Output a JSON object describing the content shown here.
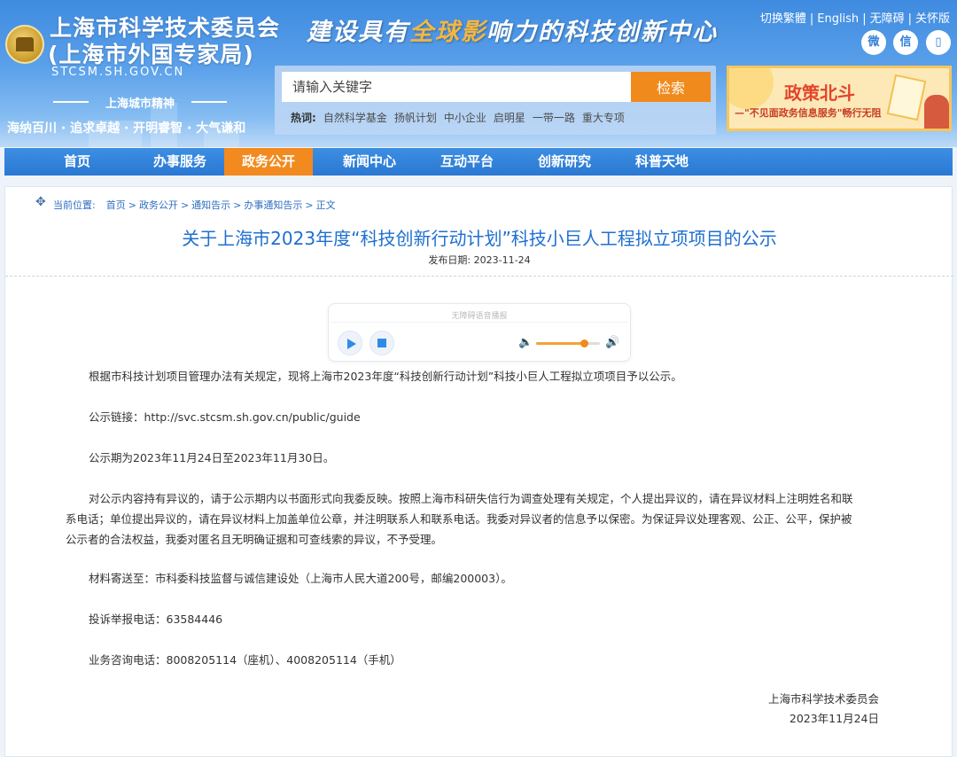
{
  "header": {
    "org_name": "上海市科学技术委员会",
    "org_name_alt": "(上海市外国专家局)",
    "domain": "STCSM.SH.GOV.CN",
    "city_spirit_label": "上海城市精神",
    "city_spirit": "海纳百川 · 追求卓越 · 开明睿智 · 大气谦和",
    "motto_pre": "建设具有",
    "motto_hl": "全球影",
    "motto_post": "响力的科技创新中心",
    "links": [
      "切换繁體",
      "English",
      "无障碍",
      "关怀版"
    ],
    "social": [
      {
        "icon": "weibo-icon",
        "glyph": "微"
      },
      {
        "icon": "wechat-icon",
        "glyph": "信"
      },
      {
        "icon": "mobile-icon",
        "glyph": "▯"
      }
    ]
  },
  "search": {
    "placeholder": "请输入关键字",
    "button": "检索",
    "hot_label": "热词:",
    "hot_words": [
      "自然科学基金",
      "扬帆计划",
      "中小企业",
      "启明星",
      "一带一路",
      "重大专项"
    ]
  },
  "banner": {
    "title": "政策北斗",
    "subtitle": "—\"不见面政务信息服务\"畅行无阻"
  },
  "nav": {
    "items": [
      "首页",
      "办事服务",
      "政务公开",
      "新闻中心",
      "互动平台",
      "创新研究",
      "科普天地"
    ],
    "active_index": 2
  },
  "breadcrumb": {
    "label": "当前位置:",
    "items": [
      "首页",
      "政务公开",
      "通知告示",
      "办事通知告示",
      "正文"
    ]
  },
  "article": {
    "title": "关于上海市2023年度“科技创新行动计划”科技小巨人工程拟立项项目的公示",
    "date_label": "发布日期:",
    "date": "2023-11-24",
    "player_title": "无障碍语音播报",
    "volume_level": 0.75,
    "paragraphs": [
      "根据市科技计划项目管理办法有关规定，现将上海市2023年度“科技创新行动计划”科技小巨人工程拟立项项目予以公示。",
      "公示链接：http://svc.stcsm.sh.gov.cn/public/guide",
      "公示期为2023年11月24日至2023年11月30日。",
      "对公示内容持有异议的，请于公示期内以书面形式向我委反映。按照上海市科研失信行为调查处理有关规定，个人提出异议的，请在异议材料上注明姓名和联系电话；单位提出异议的，请在异议材料上加盖单位公章，并注明联系人和联系电话。我委对异议者的信息予以保密。为保证异议处理客观、公正、公平，保护被公示者的合法权益，我委对匿名且无明确证据和可查线索的异议，不予受理。",
      "材料寄送至：市科委科技监督与诚信建设处（上海市人民大道200号，邮编200003）。",
      "投诉举报电话：63584446",
      "业务咨询电话：8008205114（座机）、4008205114（手机）"
    ],
    "signature_org": "上海市科学技术委员会",
    "signature_date": "2023年11月24日"
  }
}
